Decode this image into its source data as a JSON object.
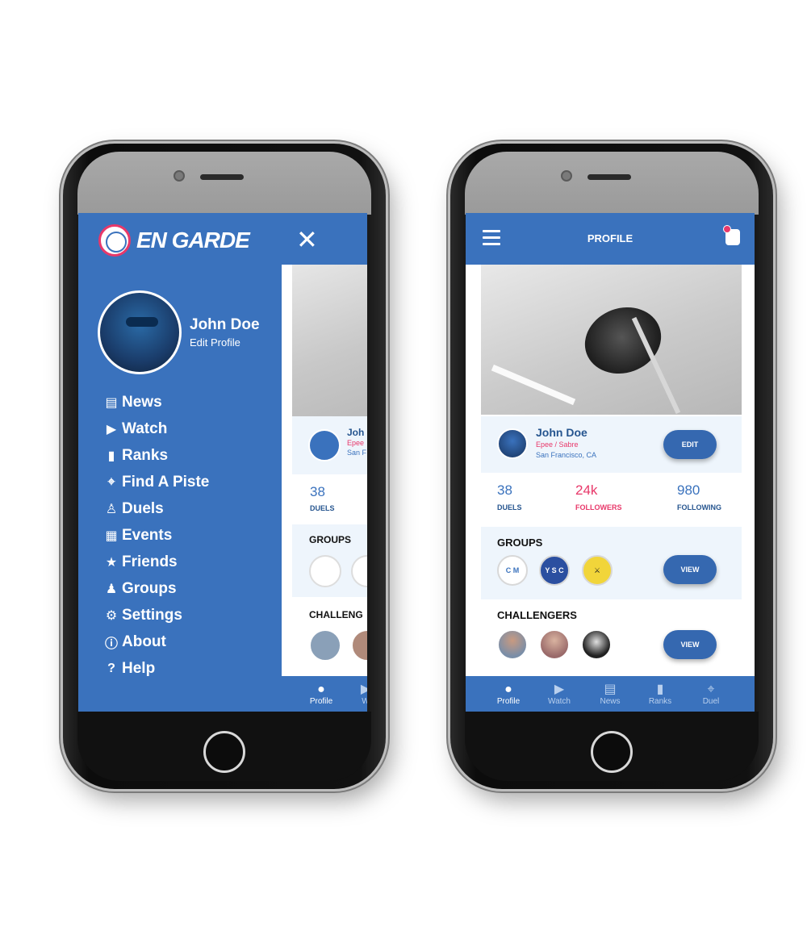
{
  "drawer": {
    "logo_text": "EN GARDE",
    "close_glyph": "✕",
    "user_name": "John Doe",
    "edit_profile": "Edit Profile",
    "menu": [
      {
        "label": "News",
        "icon": "news-icon",
        "glyph": "▤"
      },
      {
        "label": "Watch",
        "icon": "watch-icon",
        "glyph": "▶"
      },
      {
        "label": "Ranks",
        "icon": "ranks-icon",
        "glyph": "▮"
      },
      {
        "label": "Find A Piste",
        "icon": "location-pin-icon",
        "glyph": "⌖"
      },
      {
        "label": "Duels",
        "icon": "duels-icon",
        "glyph": "♙"
      },
      {
        "label": "Events",
        "icon": "calendar-icon",
        "glyph": "▦"
      },
      {
        "label": "Friends",
        "icon": "star-icon",
        "glyph": "★"
      },
      {
        "label": "Groups",
        "icon": "group-icon",
        "glyph": "♟"
      },
      {
        "label": "Settings",
        "icon": "gear-icon",
        "glyph": "⚙"
      },
      {
        "label": "About",
        "icon": "info-icon",
        "glyph": "ⓘ"
      },
      {
        "label": "Help",
        "icon": "help-icon",
        "glyph": "?"
      }
    ],
    "peek": {
      "name": "Joh",
      "style": "Epee",
      "location": "San F",
      "duels_count": "38",
      "duels_label": "DUELS",
      "groups_title": "GROUPS",
      "challengers_title": "CHALLENG",
      "nav_profile": "Profile",
      "nav_watch": "W"
    }
  },
  "profile": {
    "appbar_title": "PROFILE",
    "name": "John Doe",
    "style": "Epee / Sabre",
    "location": "San Francisco, CA",
    "edit_label": "EDIT",
    "stats": [
      {
        "value": "38",
        "label": "DUELS",
        "color": "#3a72bd"
      },
      {
        "value": "24k",
        "label": "FOLLOWERS",
        "color": "#e8386a"
      },
      {
        "value": "980",
        "label": "FOLLOWING",
        "color": "#3a72bd"
      }
    ],
    "groups_title": "GROUPS",
    "groups_view_label": "VIEW",
    "group_badges": [
      "C M",
      "Y S C",
      "⚔"
    ],
    "challengers_title": "CHALLENGERS",
    "challengers_view_label": "VIEW",
    "bottom_nav": [
      {
        "label": "Profile",
        "icon": "profile-icon",
        "glyph": "●"
      },
      {
        "label": "Watch",
        "icon": "watch-icon",
        "glyph": "▶"
      },
      {
        "label": "News",
        "icon": "news-icon",
        "glyph": "▤"
      },
      {
        "label": "Ranks",
        "icon": "ranks-icon",
        "glyph": "▮"
      },
      {
        "label": "Duel",
        "icon": "location-pin-icon",
        "glyph": "⌖"
      }
    ]
  },
  "colors": {
    "brand_blue": "#3a72bd",
    "accent_pink": "#e8386a",
    "card_bg": "#eef5fc"
  }
}
